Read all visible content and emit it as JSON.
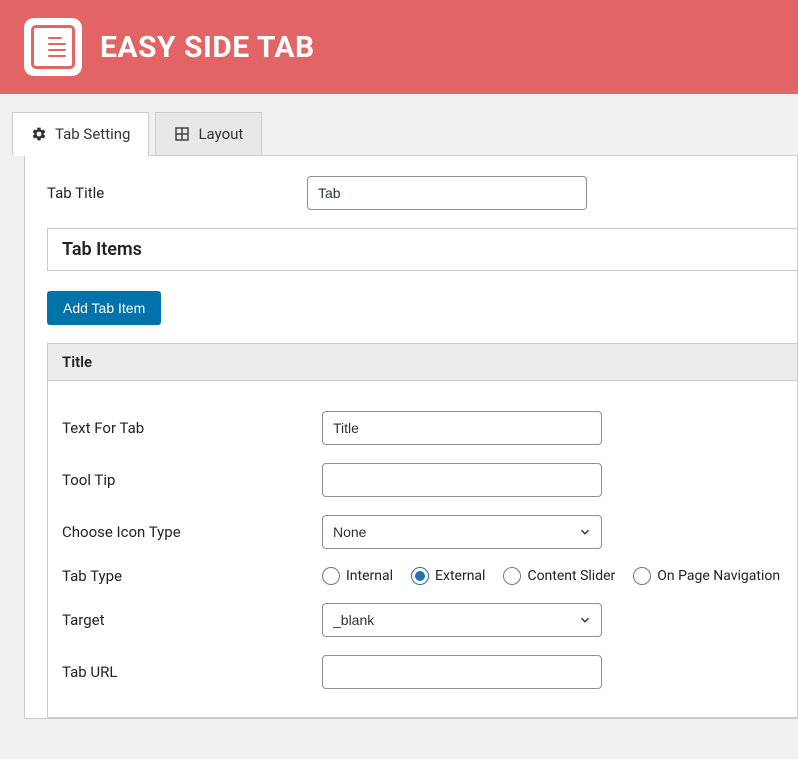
{
  "header": {
    "title": "EASY SIDE TAB"
  },
  "tabs": {
    "setting": "Tab Setting",
    "layout": "Layout"
  },
  "form": {
    "tab_title_label": "Tab Title",
    "tab_title_value": "Tab",
    "section_tab_items": "Tab Items",
    "add_tab_item": "Add Tab Item",
    "item_header": "Title",
    "text_for_tab_label": "Text For Tab",
    "text_for_tab_value": "Title",
    "tool_tip_label": "Tool Tip",
    "tool_tip_value": "",
    "choose_icon_type_label": "Choose Icon Type",
    "choose_icon_type_value": "None",
    "tab_type_label": "Tab Type",
    "tab_type_options": {
      "internal": "Internal",
      "external": "External",
      "content_slider": "Content Slider",
      "on_page_navigation": "On Page Navigation"
    },
    "tab_type_selected": "external",
    "target_label": "Target",
    "target_value": "_blank",
    "tab_url_label": "Tab URL",
    "tab_url_value": ""
  }
}
